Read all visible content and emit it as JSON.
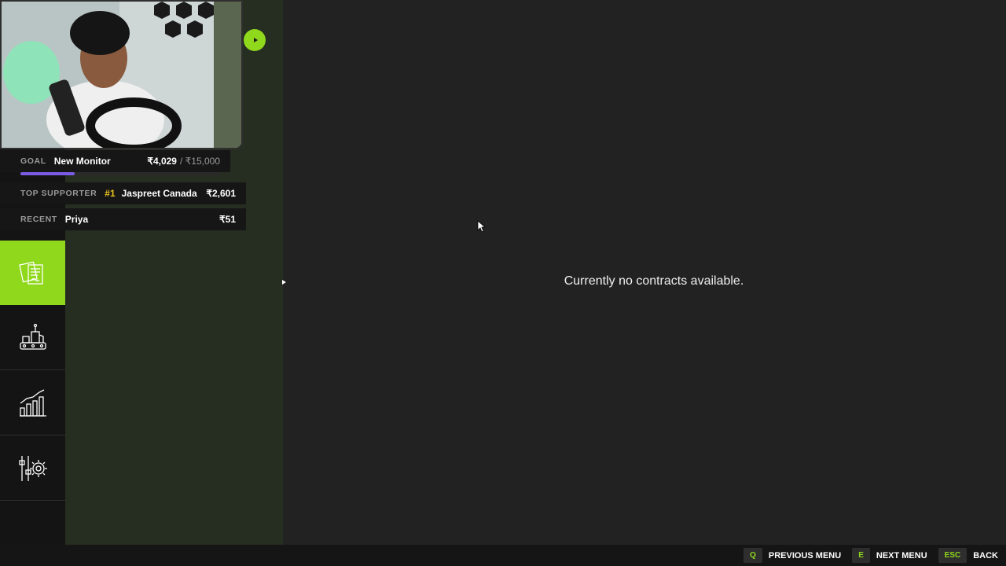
{
  "colors": {
    "accent": "#8fd81c",
    "background": "#222222",
    "rail": "#141414",
    "panel": "#262d21",
    "goal_progress": "#7a5ce6",
    "rank_gold": "#e8c21d"
  },
  "sidebar": {
    "items": [
      {
        "icon": "contracts-icon",
        "active": true
      },
      {
        "icon": "factory-icon",
        "active": false
      },
      {
        "icon": "statistics-icon",
        "active": false
      },
      {
        "icon": "settings-icon",
        "active": false
      }
    ]
  },
  "stream_overlay": {
    "goal": {
      "label": "GOAL",
      "name": "New Monitor",
      "current": "₹4,029",
      "target": "/ ₹15,000",
      "progress": 0.27
    },
    "top_supporter": {
      "label": "TOP SUPPORTER",
      "rank": "#1",
      "name": "Jaspreet Canada",
      "amount": "₹2,601"
    },
    "recent": {
      "label": "RECENT",
      "name": "Priya",
      "amount": "₹51"
    }
  },
  "main": {
    "empty_message": "Currently no contracts available."
  },
  "footer": {
    "hints": [
      {
        "key": "Q",
        "label": "PREVIOUS MENU"
      },
      {
        "key": "E",
        "label": "NEXT MENU"
      },
      {
        "key": "ESC",
        "label": "BACK"
      }
    ]
  }
}
